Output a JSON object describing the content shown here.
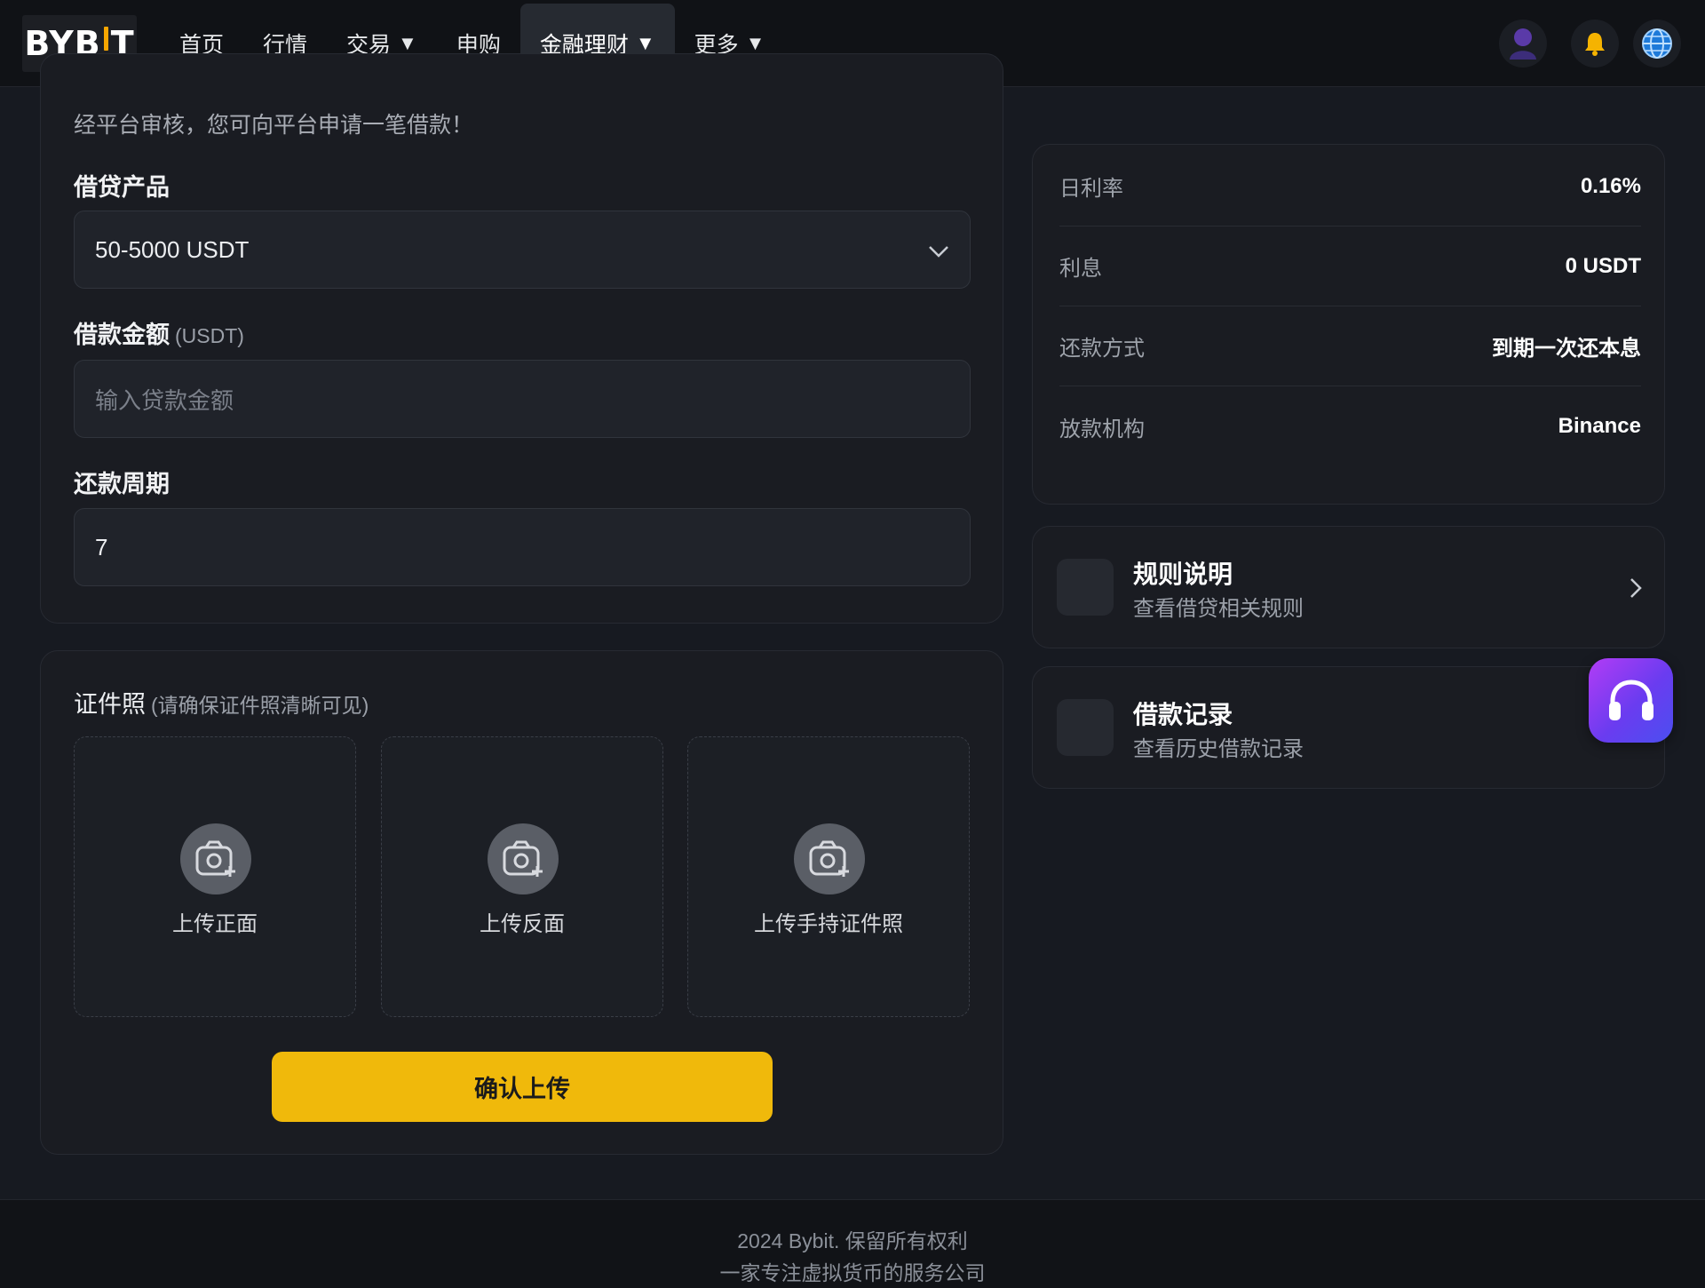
{
  "header": {
    "logo": "BYBIT",
    "nav": [
      {
        "label": "首页",
        "caret": ""
      },
      {
        "label": "行情",
        "caret": ""
      },
      {
        "label": "交易",
        "caret": "▼"
      },
      {
        "label": "申购",
        "caret": ""
      },
      {
        "label": "金融理财",
        "caret": "▼",
        "active": true
      },
      {
        "label": "更多",
        "caret": "▼"
      }
    ],
    "icons": [
      "user-icon",
      "bell-icon",
      "globe-icon"
    ]
  },
  "form": {
    "intro": "经平台审核，您可向平台申请一笔借款！",
    "product_label": "借贷产品",
    "product_value": "50-5000 USDT",
    "amount_label": "借款金额",
    "amount_unit": "(USDT)",
    "amount_placeholder": "输入贷款金额",
    "period_label": "还款周期",
    "period_value": "7"
  },
  "upload": {
    "title": "证件照",
    "hint": "(请确保证件照清晰可见)",
    "tiles": [
      "上传正面",
      "上传反面",
      "上传手持证件照"
    ],
    "confirm": "确认上传"
  },
  "info": {
    "rows": [
      {
        "key": "日利率",
        "value": "0.16%"
      },
      {
        "key": "利息",
        "value": "0 USDT"
      },
      {
        "key": "还款方式",
        "value": "到期一次还本息"
      },
      {
        "key": "放款机构",
        "value": "Binance"
      }
    ]
  },
  "links": [
    {
      "title": "规则说明",
      "subtitle": "查看借贷相关规则"
    },
    {
      "title": "借款记录",
      "subtitle": "查看历史借款记录"
    }
  ],
  "footer": {
    "line1": "2024 Bybit. 保留所有权利",
    "line2": "一家专注虚拟货币的服务公司"
  },
  "colors": {
    "accent": "#f0b90b",
    "logo_bar": "#f7a600",
    "support_gradient": [
      "#b23cf5",
      "#4b4ff0"
    ]
  }
}
